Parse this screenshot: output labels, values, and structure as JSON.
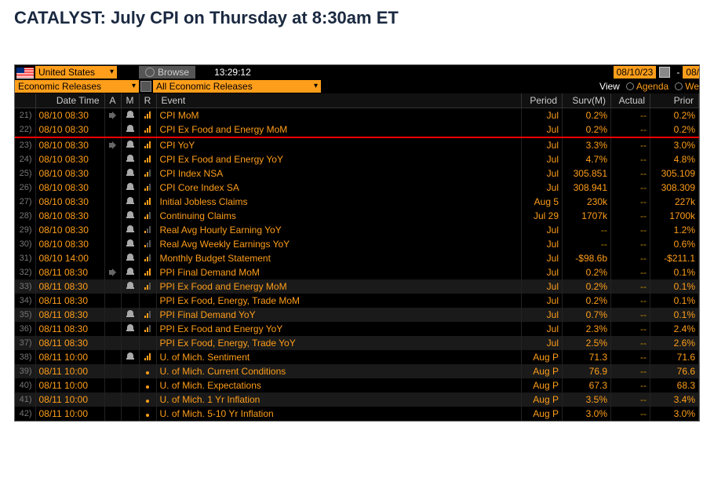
{
  "headline": "CATALYST: July CPI on Thursday at 8:30am ET",
  "top": {
    "country": "United States",
    "browse": "Browse",
    "clock": "13:29:12",
    "date_from": "08/10/23",
    "date_to": "08/"
  },
  "filters": {
    "group": "Economic Releases",
    "sub": "All Economic Releases",
    "view_label": "View",
    "agenda": "Agenda",
    "weekly": "We"
  },
  "columns": {
    "dt": "Date Time",
    "a": "A",
    "m": "M",
    "r": "R",
    "event": "Event",
    "period": "Period",
    "surv": "Surv(M)",
    "actual": "Actual",
    "prior": "Prior"
  },
  "rows": [
    {
      "n": "21)",
      "dt": "08/10 08:30",
      "a": true,
      "m": true,
      "r": "bars3",
      "evt": "CPI MoM",
      "period": "Jul",
      "surv": "0.2%",
      "actual": "--",
      "prior": "0.2%",
      "sel": true
    },
    {
      "n": "22)",
      "dt": "08/10 08:30",
      "a": false,
      "m": true,
      "r": "bars3",
      "evt": "CPI Ex Food and Energy MoM",
      "period": "Jul",
      "surv": "0.2%",
      "actual": "--",
      "prior": "0.2%",
      "sel": true,
      "red": true
    },
    {
      "n": "23)",
      "dt": "08/10 08:30",
      "a": true,
      "m": true,
      "r": "bars3",
      "evt": "CPI YoY",
      "period": "Jul",
      "surv": "3.3%",
      "actual": "--",
      "prior": "3.0%",
      "sel": true
    },
    {
      "n": "24)",
      "dt": "08/10 08:30",
      "a": false,
      "m": true,
      "r": "bars3",
      "evt": "CPI Ex Food and Energy YoY",
      "period": "Jul",
      "surv": "4.7%",
      "actual": "--",
      "prior": "4.8%",
      "sel": true
    },
    {
      "n": "25)",
      "dt": "08/10 08:30",
      "a": false,
      "m": true,
      "r": "bars2",
      "evt": "CPI Index NSA",
      "period": "Jul",
      "surv": "305.851",
      "actual": "--",
      "prior": "305.109",
      "sel": true
    },
    {
      "n": "26)",
      "dt": "08/10 08:30",
      "a": false,
      "m": true,
      "r": "bars2",
      "evt": "CPI Core Index SA",
      "period": "Jul",
      "surv": "308.941",
      "actual": "--",
      "prior": "308.309",
      "sel": true
    },
    {
      "n": "27)",
      "dt": "08/10 08:30",
      "a": false,
      "m": true,
      "r": "bars3",
      "evt": "Initial Jobless Claims",
      "period": "Aug 5",
      "surv": "230k",
      "actual": "--",
      "prior": "227k",
      "sel": true
    },
    {
      "n": "28)",
      "dt": "08/10 08:30",
      "a": false,
      "m": true,
      "r": "bars2",
      "evt": "Continuing Claims",
      "period": "Jul 29",
      "surv": "1707k",
      "actual": "--",
      "prior": "1700k",
      "sel": true
    },
    {
      "n": "29)",
      "dt": "08/10 08:30",
      "a": false,
      "m": true,
      "r": "bars1",
      "evt": "Real Avg Hourly Earning YoY",
      "period": "Jul",
      "surv": "--",
      "actual": "--",
      "prior": "1.2%",
      "sel": true
    },
    {
      "n": "30)",
      "dt": "08/10 08:30",
      "a": false,
      "m": true,
      "r": "bars1",
      "evt": "Real Avg Weekly Earnings YoY",
      "period": "Jul",
      "surv": "--",
      "actual": "--",
      "prior": "0.6%",
      "sel": true
    },
    {
      "n": "31)",
      "dt": "08/10 14:00",
      "a": false,
      "m": true,
      "r": "bars2",
      "evt": "Monthly Budget Statement",
      "period": "Jul",
      "surv": "-$98.6b",
      "actual": "--",
      "prior": "-$211.1",
      "sel": true
    },
    {
      "n": "32)",
      "dt": "08/11 08:30",
      "a": true,
      "m": true,
      "r": "bars3",
      "evt": "PPI Final Demand MoM",
      "period": "Jul",
      "surv": "0.2%",
      "actual": "--",
      "prior": "0.1%"
    },
    {
      "n": "33)",
      "dt": "08/11 08:30",
      "a": false,
      "m": true,
      "r": "bars2",
      "evt": "PPI Ex Food and Energy MoM",
      "period": "Jul",
      "surv": "0.2%",
      "actual": "--",
      "prior": "0.1%"
    },
    {
      "n": "34)",
      "dt": "08/11 08:30",
      "a": false,
      "m": false,
      "r": "none",
      "evt": "PPI Ex Food, Energy, Trade MoM",
      "period": "Jul",
      "surv": "0.2%",
      "actual": "--",
      "prior": "0.1%"
    },
    {
      "n": "35)",
      "dt": "08/11 08:30",
      "a": false,
      "m": true,
      "r": "bars2",
      "evt": "PPI Final Demand YoY",
      "period": "Jul",
      "surv": "0.7%",
      "actual": "--",
      "prior": "0.1%"
    },
    {
      "n": "36)",
      "dt": "08/11 08:30",
      "a": false,
      "m": true,
      "r": "bars2",
      "evt": "PPI Ex Food and Energy YoY",
      "period": "Jul",
      "surv": "2.3%",
      "actual": "--",
      "prior": "2.4%"
    },
    {
      "n": "37)",
      "dt": "08/11 08:30",
      "a": false,
      "m": false,
      "r": "none",
      "evt": "PPI Ex Food, Energy, Trade YoY",
      "period": "Jul",
      "surv": "2.5%",
      "actual": "--",
      "prior": "2.6%"
    },
    {
      "n": "38)",
      "dt": "08/11 10:00",
      "a": false,
      "m": true,
      "r": "bars3",
      "evt": "U. of Mich. Sentiment",
      "period": "Aug P",
      "surv": "71.3",
      "actual": "--",
      "prior": "71.6"
    },
    {
      "n": "39)",
      "dt": "08/11 10:00",
      "a": false,
      "m": false,
      "r": "dot",
      "evt": "U. of Mich. Current Conditions",
      "period": "Aug P",
      "surv": "76.9",
      "actual": "--",
      "prior": "76.6"
    },
    {
      "n": "40)",
      "dt": "08/11 10:00",
      "a": false,
      "m": false,
      "r": "dot",
      "evt": "U. of Mich. Expectations",
      "period": "Aug P",
      "surv": "67.3",
      "actual": "--",
      "prior": "68.3"
    },
    {
      "n": "41)",
      "dt": "08/11 10:00",
      "a": false,
      "m": false,
      "r": "dot",
      "evt": "U. of Mich. 1 Yr Inflation",
      "period": "Aug P",
      "surv": "3.5%",
      "actual": "--",
      "prior": "3.4%"
    },
    {
      "n": "42)",
      "dt": "08/11 10:00",
      "a": false,
      "m": false,
      "r": "dot",
      "evt": "U. of Mich. 5-10 Yr Inflation",
      "period": "Aug P",
      "surv": "3.0%",
      "actual": "--",
      "prior": "3.0%"
    }
  ]
}
